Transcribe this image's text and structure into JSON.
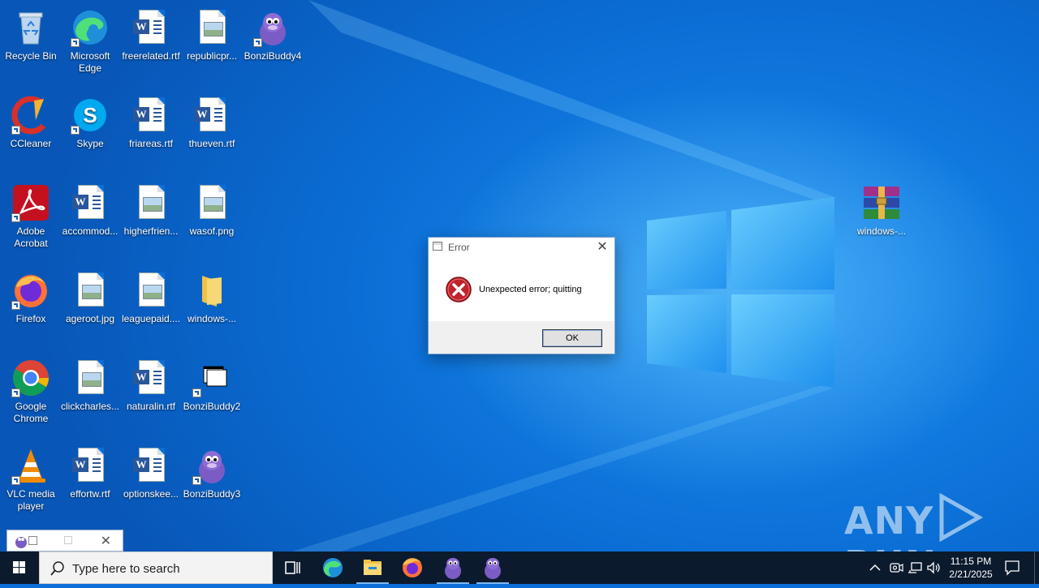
{
  "desktop": {
    "icons": [
      {
        "id": "recycle-bin",
        "label": "Recycle Bin",
        "icon": "recycle-bin-icon"
      },
      {
        "id": "microsoft-edge",
        "label": "Microsoft Edge",
        "icon": "edge-icon"
      },
      {
        "id": "freerelated",
        "label": "freerelated.rtf",
        "icon": "word-document-icon"
      },
      {
        "id": "republicpr",
        "label": "republicpr...",
        "icon": "image-file-icon"
      },
      {
        "id": "bonzibuddy4",
        "label": "BonziBuddy4",
        "icon": "bonzibuddy-icon"
      },
      {
        "id": "ccleaner",
        "label": "CCleaner",
        "icon": "ccleaner-icon"
      },
      {
        "id": "skype",
        "label": "Skype",
        "icon": "skype-icon"
      },
      {
        "id": "friareas",
        "label": "friareas.rtf",
        "icon": "word-document-icon"
      },
      {
        "id": "thueven",
        "label": "thueven.rtf",
        "icon": "word-document-icon"
      },
      {
        "id": "adobe-acrobat",
        "label": "Adobe Acrobat",
        "icon": "acrobat-icon"
      },
      {
        "id": "accommod",
        "label": "accommod...",
        "icon": "word-document-icon"
      },
      {
        "id": "higherfrien",
        "label": "higherfrien...",
        "icon": "image-file-icon"
      },
      {
        "id": "wasof",
        "label": "wasof.png",
        "icon": "image-file-icon"
      },
      {
        "id": "firefox",
        "label": "Firefox",
        "icon": "firefox-icon"
      },
      {
        "id": "ageroot",
        "label": "ageroot.jpg",
        "icon": "image-file-icon"
      },
      {
        "id": "leaguepaid",
        "label": "leaguepaid....",
        "icon": "image-file-icon"
      },
      {
        "id": "windows-folder",
        "label": "windows-...",
        "icon": "folder-icon"
      },
      {
        "id": "google-chrome",
        "label": "Google Chrome",
        "icon": "chrome-icon"
      },
      {
        "id": "clickcharles",
        "label": "clickcharles...",
        "icon": "image-file-icon"
      },
      {
        "id": "naturalin",
        "label": "naturalin.rtf",
        "icon": "word-document-icon"
      },
      {
        "id": "bonzibuddy2",
        "label": "BonziBuddy2",
        "icon": "blank-window-icon"
      },
      {
        "id": "vlc",
        "label": "VLC media player",
        "icon": "vlc-icon"
      },
      {
        "id": "effortw",
        "label": "effortw.rtf",
        "icon": "word-document-icon"
      },
      {
        "id": "optionskee",
        "label": "optionskee...",
        "icon": "word-document-icon"
      },
      {
        "id": "bonzibuddy3",
        "label": "BonziBuddy3",
        "icon": "bonzibuddy-icon"
      },
      {
        "id": "windows-rar",
        "label": "windows-...",
        "icon": "winrar-archive-icon"
      }
    ]
  },
  "dialog": {
    "title": "Error",
    "message": "Unexpected error; quitting",
    "ok_label": "OK",
    "close_glyph": "✕",
    "icon": "error-icon"
  },
  "watermark": {
    "text_left": "ANY",
    "text_right": "RUN"
  },
  "taskbar": {
    "search_placeholder": "Type here to search",
    "pinned": [
      "task-view-icon",
      "edge-icon",
      "file-explorer-icon",
      "firefox-icon",
      "bonzibuddy-icon",
      "bonzibuddy-icon"
    ],
    "clock_time": "11:15 PM",
    "clock_date": "2/21/2025"
  },
  "colors": {
    "desktop_blue": "#0b6fd6",
    "taskbar": "#0c1a2e",
    "error_red": "#c0232b",
    "word_blue": "#2b579a"
  }
}
